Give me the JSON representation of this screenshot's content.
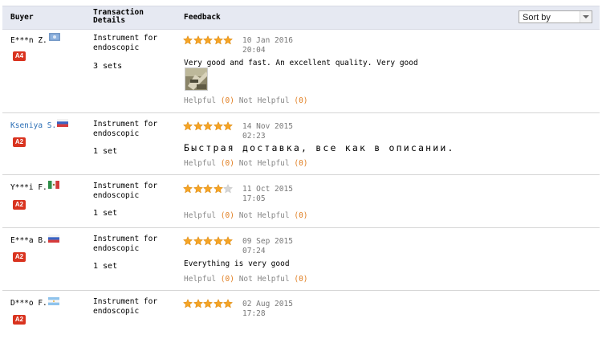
{
  "header": {
    "buyer": "Buyer",
    "transaction_line1": "Transaction",
    "transaction_line2": "Details",
    "feedback": "Feedback",
    "sort_label": "Sort by"
  },
  "colors": {
    "star": "#f5a425",
    "star_empty": "#d6d6d6",
    "badge": "#d9331f",
    "link": "#2a6eb5",
    "count": "#e07d1f"
  },
  "reviews": [
    {
      "buyer": "E***n Z.",
      "flag": "flag-icon-blue",
      "badge": "A4",
      "product_line1": "Instrument for",
      "product_line2": "endoscopic",
      "quantity": "3 sets",
      "rating": 5,
      "date": "10 Jan 2016",
      "time": "20:04",
      "text": "Very good and fast. An excellent quality. Very good",
      "has_photo": true,
      "helpful_label": "Helpful",
      "helpful_count": "(0)",
      "not_helpful_label": "Not Helpful",
      "not_helpful_count": "(0)"
    },
    {
      "buyer": "Kseniya S.",
      "flag": "flag-icon-russia",
      "badge": "A2",
      "product_line1": "Instrument for",
      "product_line2": "endoscopic",
      "quantity": "1 set",
      "rating": 5,
      "date": "14 Nov 2015",
      "time": "02:23",
      "text": "Быстрая доставка, все как в описании.",
      "has_photo": false,
      "helpful_label": "Helpful",
      "helpful_count": "(0)",
      "not_helpful_label": "Not Helpful",
      "not_helpful_count": "(0)"
    },
    {
      "buyer": "Y***i F.",
      "flag": "flag-icon-mexico",
      "badge": "A2",
      "product_line1": "Instrument for",
      "product_line2": "endoscopic",
      "quantity": "1 set",
      "rating": 4,
      "date": "11 Oct 2015",
      "time": "17:05",
      "text": "",
      "has_photo": false,
      "helpful_label": "Helpful",
      "helpful_count": "(0)",
      "not_helpful_label": "Not Helpful",
      "not_helpful_count": "(0)"
    },
    {
      "buyer": "E***a B.",
      "flag": "flag-icon-russia",
      "badge": "A2",
      "product_line1": "Instrument for",
      "product_line2": "endoscopic",
      "quantity": "1 set",
      "rating": 5,
      "date": "09 Sep 2015",
      "time": "07:24",
      "text": "Everything is very good",
      "has_photo": false,
      "helpful_label": "Helpful",
      "helpful_count": "(0)",
      "not_helpful_label": "Not Helpful",
      "not_helpful_count": "(0)"
    },
    {
      "buyer": "D***o F.",
      "flag": "flag-icon-argentina",
      "badge": "A2",
      "product_line1": "Instrument for",
      "product_line2": "endoscopic",
      "quantity": "",
      "rating": 5,
      "date": "02 Aug 2015",
      "time": "17:28",
      "text": "",
      "has_photo": false,
      "helpful_label": "",
      "helpful_count": "",
      "not_helpful_label": "",
      "not_helpful_count": ""
    }
  ]
}
